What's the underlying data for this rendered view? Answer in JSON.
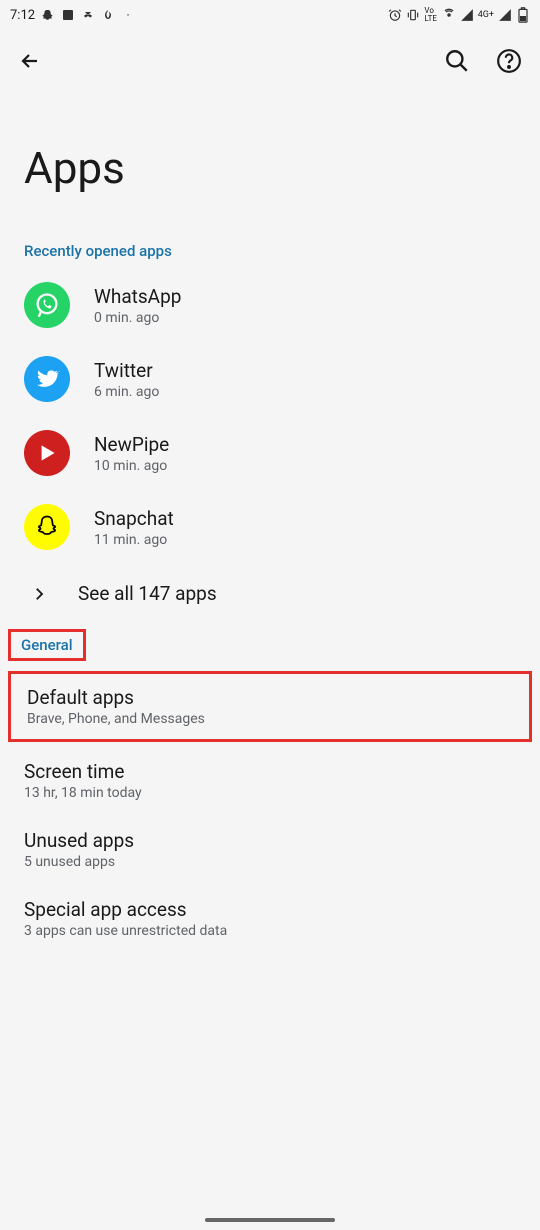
{
  "status": {
    "time": "7:12",
    "network_label": "4G+"
  },
  "page": {
    "title": "Apps"
  },
  "sections": {
    "recent_header": "Recently opened apps",
    "general_header": "General"
  },
  "recent_apps": [
    {
      "name": "WhatsApp",
      "subtitle": "0 min. ago"
    },
    {
      "name": "Twitter",
      "subtitle": "6 min. ago"
    },
    {
      "name": "NewPipe",
      "subtitle": "10 min. ago"
    },
    {
      "name": "Snapchat",
      "subtitle": "11 min. ago"
    }
  ],
  "see_all": "See all 147 apps",
  "settings": [
    {
      "title": "Default apps",
      "subtitle": "Brave, Phone, and Messages"
    },
    {
      "title": "Screen time",
      "subtitle": "13 hr, 18 min today"
    },
    {
      "title": "Unused apps",
      "subtitle": "5 unused apps"
    },
    {
      "title": "Special app access",
      "subtitle": "3 apps can use unrestricted data"
    }
  ]
}
